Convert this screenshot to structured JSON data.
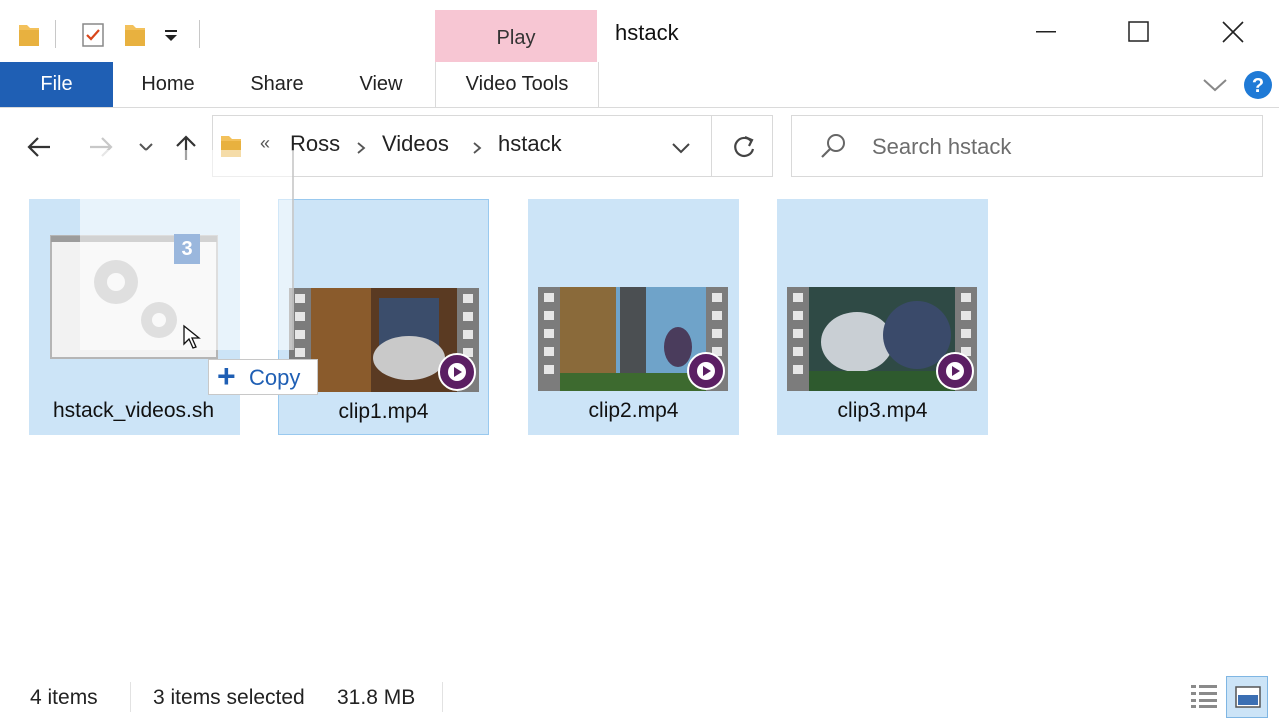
{
  "window": {
    "title": "hstack"
  },
  "quick_access": {
    "dropdown_icon": "chevron-down-icon"
  },
  "contextual_tab": {
    "label": "Play"
  },
  "ribbon": {
    "tabs": [
      {
        "label": "File"
      },
      {
        "label": "Home"
      },
      {
        "label": "Share"
      },
      {
        "label": "View"
      },
      {
        "label": "Video Tools"
      }
    ]
  },
  "address": {
    "overflow": "«",
    "crumbs": [
      "Ross",
      "Videos",
      "hstack"
    ]
  },
  "search": {
    "placeholder": "Search hstack"
  },
  "files": [
    {
      "name": "hstack_videos.sh",
      "badge": "3"
    },
    {
      "name": "clip1.mp4"
    },
    {
      "name": "clip2.mp4"
    },
    {
      "name": "clip3.mp4"
    }
  ],
  "drag": {
    "plus": "+",
    "label": "Copy"
  },
  "status": {
    "count": "4 items",
    "selected": "3 items selected",
    "size": "31.8 MB"
  },
  "colors": {
    "file_tab": "#1f5fb4",
    "contextual_tab": "#f7c6d3",
    "selection": "#cce4f7",
    "help": "#1f7ad6"
  }
}
